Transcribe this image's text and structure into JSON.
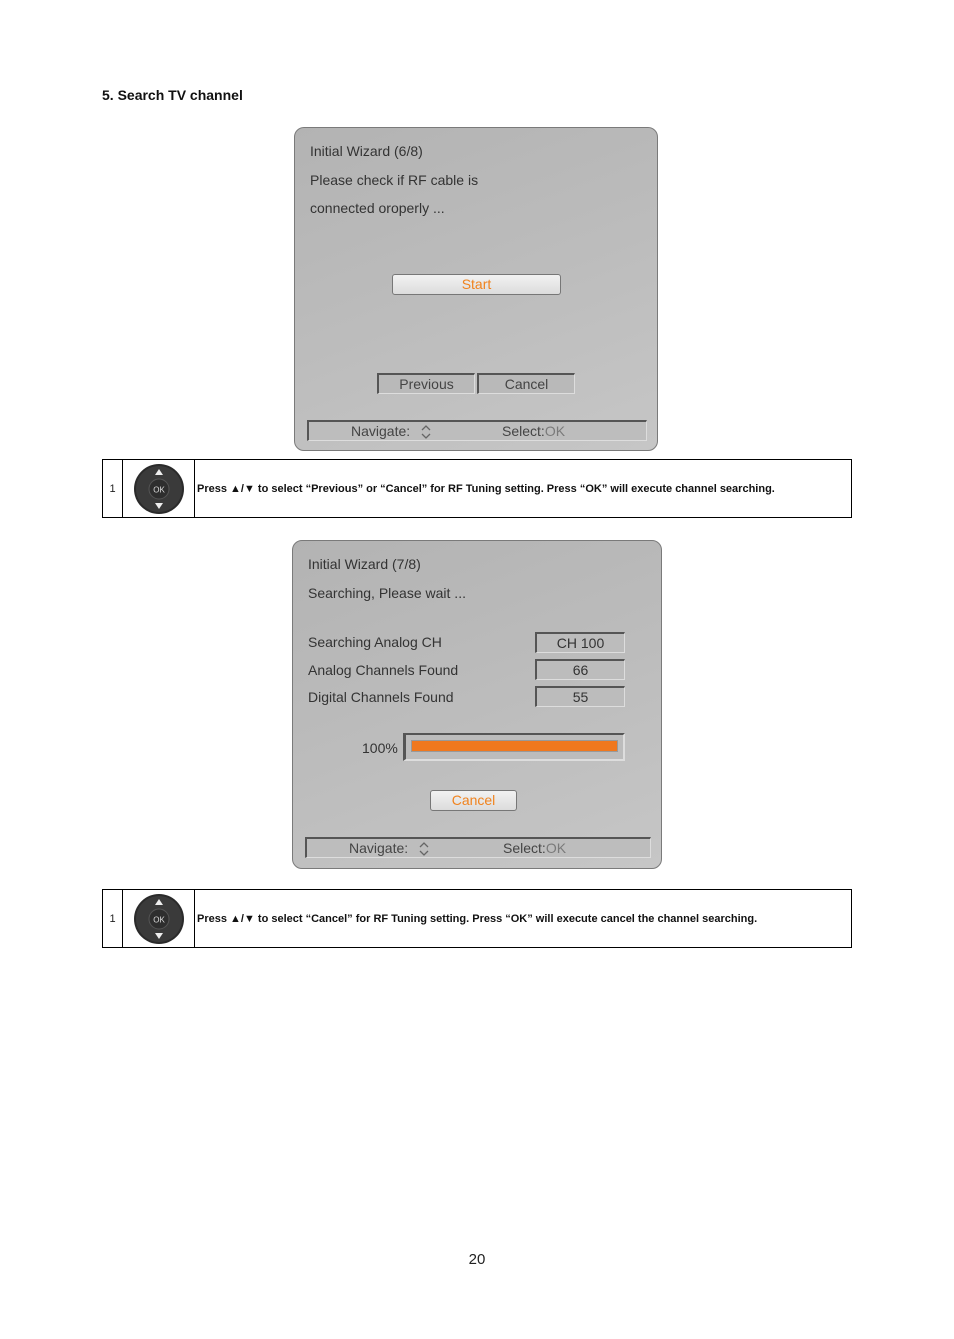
{
  "section_title": "5. Search TV channel",
  "wizard6": {
    "title": "Initial Wizard (6/8)",
    "message_line1": "Please check if RF cable is",
    "message_line2": "connected oroperly ...",
    "start_button": "Start",
    "previous_button": "Previous",
    "cancel_button": "Cancel",
    "status": {
      "navigate_label": "Navigate:",
      "select_label": "Select:",
      "select_key": "OK"
    }
  },
  "instruction1": {
    "number": "1",
    "icon": "dpad-ok-icon",
    "text": "Press ▲/▼ to select “Previous” or “Cancel” for RF Tuning setting. Press “OK” will execute channel searching."
  },
  "wizard7": {
    "title": "Initial Wizard (7/8)",
    "message": "Searching, Please wait ...",
    "rows": [
      {
        "label": "Searching Analog CH",
        "value": "CH 100"
      },
      {
        "label": "Analog Channels Found",
        "value": "66"
      },
      {
        "label": "Digital Channels Found",
        "value": "55"
      }
    ],
    "progress_label": "100%",
    "progress_percent": 100,
    "progress_color": "#f0781e",
    "cancel_button": "Cancel",
    "status": {
      "navigate_label": "Navigate:",
      "select_label": "Select:",
      "select_key": "OK"
    }
  },
  "instruction2": {
    "number": "1",
    "icon": "dpad-ok-icon",
    "text": "Press ▲/▼ to select “Cancel” for RF Tuning setting. Press “OK” will execute cancel the channel searching."
  },
  "page_number": "20"
}
